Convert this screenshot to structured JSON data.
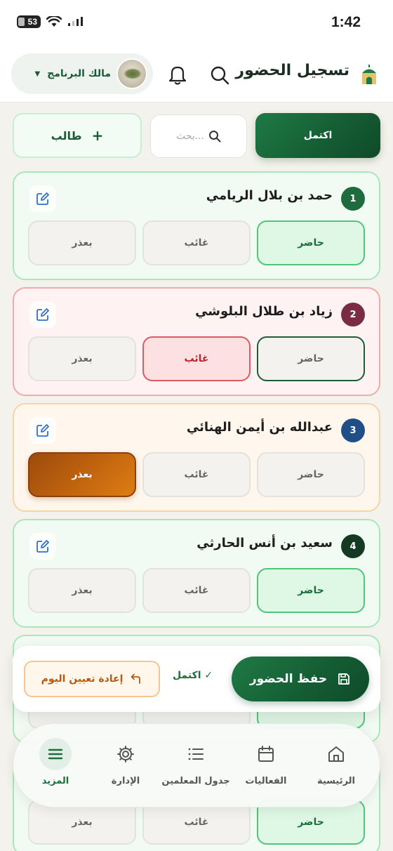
{
  "status_bar": {
    "time": "1:42",
    "battery": "53"
  },
  "header": {
    "title": "تسجيل الحضور",
    "user_name": "مالك البرنامج"
  },
  "toolbar": {
    "complete_label": "اكتمل",
    "search_placeholder": "بحث...",
    "add_student_label": "طالب"
  },
  "students": [
    {
      "num": "1",
      "name": "حمد بن بلال الريامي",
      "status": "present"
    },
    {
      "num": "2",
      "name": "زياد بن طلال البلوشي",
      "status": "absent"
    },
    {
      "num": "3",
      "name": "عبدالله بن أيمن الهنائي",
      "status": "excused"
    },
    {
      "num": "4",
      "name": "سعيد بن أنس الحارثي",
      "status": "present"
    }
  ],
  "status_labels": {
    "present": "حاضر",
    "absent": "غائب",
    "excused": "بعذر"
  },
  "actions": {
    "save_label": "حفظ الحضور",
    "done_label": "اكتمل ✓",
    "reset_label": "إعادة تعيين اليوم"
  },
  "nav": {
    "home": "الرئيسية",
    "events": "الفعاليات",
    "schedule": "جدول المعلمين",
    "admin": "الإدارة",
    "more": "المزيد"
  },
  "colors": {
    "primary_green": "#145c33",
    "present_green": "#4fc677",
    "absent_red": "#dd5a62",
    "excused_orange": "#c2650e",
    "badge_1": "#1f6b3e",
    "badge_2": "#7a2c44",
    "badge_3": "#1f4f86",
    "badge_4": "#143a24"
  }
}
